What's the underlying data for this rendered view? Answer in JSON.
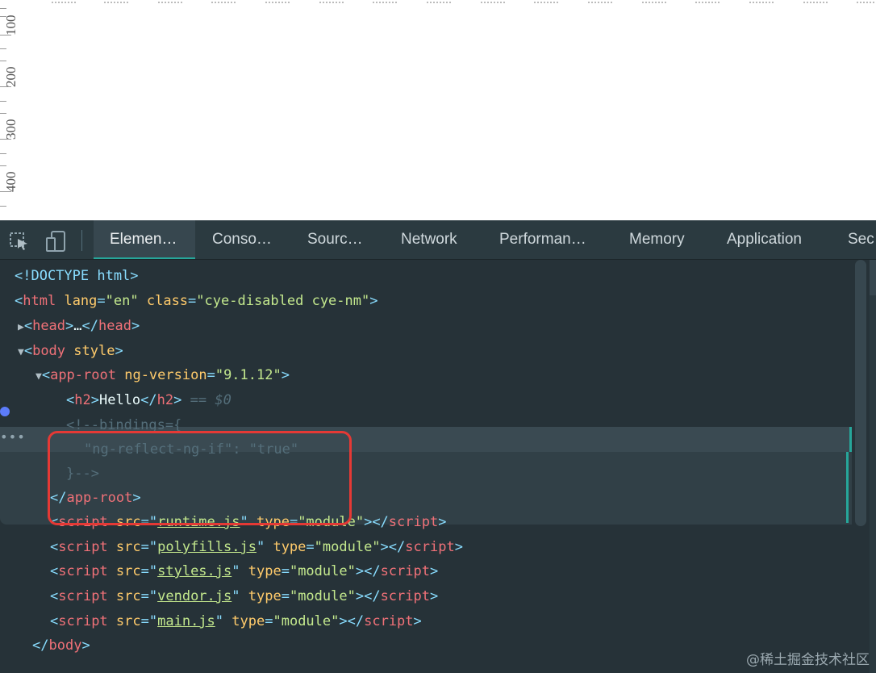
{
  "ruler": {
    "left_labels": [
      "100",
      "200",
      "300",
      "400"
    ]
  },
  "devtools": {
    "tabs": [
      {
        "label": "Elemen…",
        "active": true
      },
      {
        "label": "Conso…"
      },
      {
        "label": "Sourc…"
      },
      {
        "label": "Network"
      },
      {
        "label": "Performan…"
      },
      {
        "label": "Memory"
      },
      {
        "label": "Application"
      },
      {
        "label": "Sec"
      }
    ],
    "icons": [
      "inspect-element-icon",
      "device-toolbar-icon"
    ],
    "colors": {
      "accent": "#26a69a",
      "background": "#263238",
      "highlight_box": "#e53935"
    }
  },
  "tree": {
    "doctype": "<!DOCTYPE html>",
    "html_tag": "html",
    "html_lang_attr": "lang",
    "html_lang_val": "\"en\"",
    "html_class_attr": "class",
    "html_class_val": "\"cye-disabled cye-nm\"",
    "head_tag": "head",
    "head_ellipsis": "…",
    "body_tag": "body",
    "body_attr": "style",
    "app_root_tag": "app-root",
    "app_root_attr": "ng-version",
    "app_root_val": "\"9.1.12\"",
    "h2_tag": "h2",
    "h2_text": "Hello",
    "selected_marker": "== $0",
    "comment_line1": "<!--bindings={",
    "comment_line2": "\"ng-reflect-ng-if\": \"true\"",
    "comment_line3": "}-->",
    "close_app_root": "app-root",
    "scripts": [
      {
        "src": "runtime.js",
        "type": "\"module\""
      },
      {
        "src": "polyfills.js",
        "type": "\"module\""
      },
      {
        "src": "styles.js",
        "type": "\"module\""
      },
      {
        "src": "vendor.js",
        "type": "\"module\""
      },
      {
        "src": "main.js",
        "type": "\"module\""
      }
    ],
    "script_tag": "script",
    "src_attr": "src",
    "type_attr": "type",
    "close_body": "body"
  },
  "watermark": "@稀土掘金技术社区"
}
